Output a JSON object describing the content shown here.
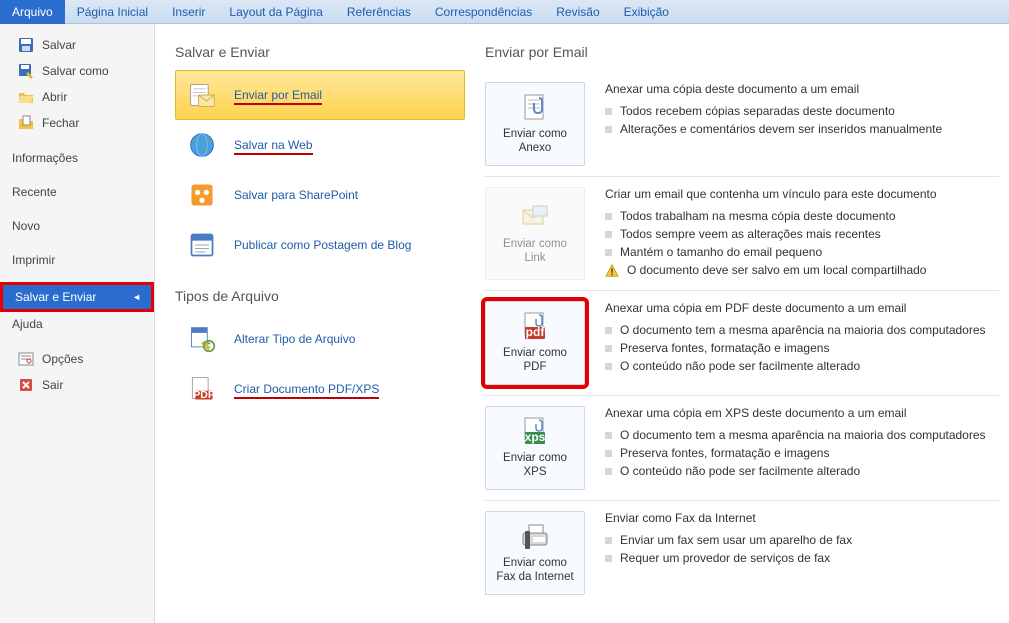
{
  "ribbon": {
    "tabs": [
      "Arquivo",
      "Página Inicial",
      "Inserir",
      "Layout da Página",
      "Referências",
      "Correspondências",
      "Revisão",
      "Exibição"
    ],
    "active": 0
  },
  "leftnav": {
    "items": [
      {
        "label": "Salvar",
        "icon": "save-icon"
      },
      {
        "label": "Salvar como",
        "icon": "saveas-icon"
      },
      {
        "label": "Abrir",
        "icon": "open-icon"
      },
      {
        "label": "Fechar",
        "icon": "close-icon"
      }
    ],
    "sections": [
      "Informações",
      "Recente",
      "Novo",
      "Imprimir",
      "Salvar e Enviar",
      "Ajuda"
    ],
    "footer": [
      {
        "label": "Opções",
        "icon": "options-icon"
      },
      {
        "label": "Sair",
        "icon": "exit-icon"
      }
    ]
  },
  "middle": {
    "heading1": "Salvar e Enviar",
    "group1": [
      {
        "label": "Enviar por Email",
        "icon": "email-icon",
        "selected": true,
        "underline": true
      },
      {
        "label": "Salvar na Web",
        "icon": "globe-icon",
        "underline": true
      },
      {
        "label": "Salvar para SharePoint",
        "icon": "sharepoint-icon"
      },
      {
        "label": "Publicar como Postagem de Blog",
        "icon": "blog-icon"
      }
    ],
    "heading2": "Tipos de Arquivo",
    "group2": [
      {
        "label": "Alterar Tipo de Arquivo",
        "icon": "changetype-icon"
      },
      {
        "label": "Criar Documento PDF/XPS",
        "icon": "pdfxps-icon",
        "underline": true
      }
    ]
  },
  "right": {
    "heading": "Enviar por Email",
    "options": [
      {
        "button": {
          "label": "Enviar como Anexo",
          "icon": "attach-icon",
          "disabled": false
        },
        "title": "Anexar uma cópia deste documento a um email",
        "bullets": [
          "Todos recebem cópias separadas deste documento",
          "Alterações e comentários devem ser inseridos manualmente"
        ]
      },
      {
        "button": {
          "label": "Enviar como Link",
          "icon": "link-icon",
          "disabled": true
        },
        "title": "Criar um email que contenha um vínculo para este documento",
        "bullets": [
          "Todos trabalham na mesma cópia deste documento",
          "Todos sempre veem as alterações mais recentes",
          "Mantém o tamanho do email pequeno"
        ],
        "warn": "O documento deve ser salvo em um local compartilhado"
      },
      {
        "button": {
          "label": "Enviar como PDF",
          "icon": "pdf-icon",
          "disabled": false,
          "redbox": true
        },
        "title": "Anexar uma cópia em PDF deste documento a um email",
        "bullets": [
          "O documento tem a mesma aparência na maioria dos computadores",
          "Preserva fontes, formatação e imagens",
          "O conteúdo não pode ser facilmente alterado"
        ]
      },
      {
        "button": {
          "label": "Enviar como XPS",
          "icon": "xps-icon",
          "disabled": false
        },
        "title": "Anexar uma cópia em XPS deste documento a um email",
        "bullets": [
          "O documento tem a mesma aparência na maioria dos computadores",
          "Preserva fontes, formatação e imagens",
          "O conteúdo não pode ser facilmente alterado"
        ]
      },
      {
        "button": {
          "label": "Enviar como Fax da Internet",
          "icon": "fax-icon",
          "disabled": false
        },
        "title": "Enviar como Fax da Internet",
        "bullets": [
          "Enviar um fax sem usar um aparelho de fax",
          "Requer um provedor de serviços de fax"
        ]
      }
    ]
  }
}
